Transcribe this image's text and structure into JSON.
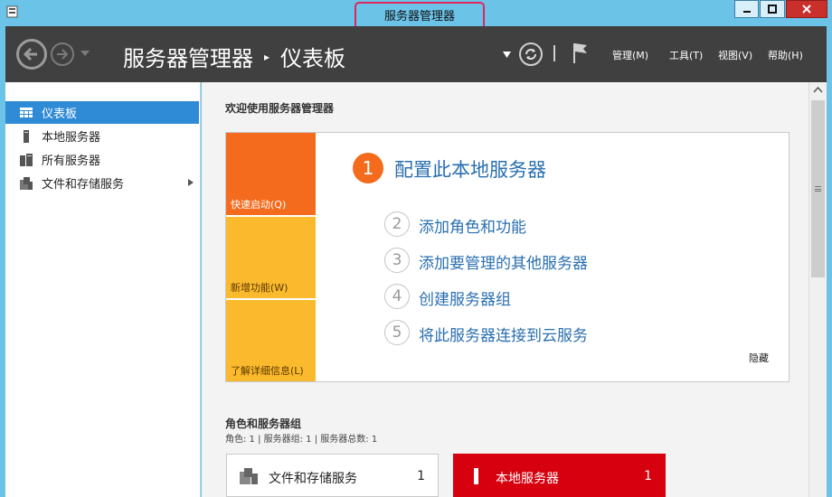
{
  "window": {
    "title": "服务器管理器"
  },
  "header": {
    "breadcrumb_root": "服务器管理器",
    "breadcrumb_sep": "▸",
    "breadcrumb_page": "仪表板",
    "menus": [
      {
        "label": "管理(M)"
      },
      {
        "label": "工具(T)"
      },
      {
        "label": "视图(V)"
      },
      {
        "label": "帮助(H)"
      }
    ]
  },
  "sidebar": {
    "items": [
      {
        "label": "仪表板",
        "icon": "dashboard-icon",
        "active": true
      },
      {
        "label": "本地服务器",
        "icon": "server-icon"
      },
      {
        "label": "所有服务器",
        "icon": "servers-icon"
      },
      {
        "label": "文件和存储服务",
        "icon": "file-storage-icon",
        "has_submenu": true
      }
    ]
  },
  "main": {
    "welcome": "欢迎使用服务器管理器",
    "quickstart": {
      "tiles": [
        "快速启动(Q)",
        "新增功能(W)",
        "了解详细信息(L)"
      ],
      "step1": {
        "num": "1",
        "text": "配置此本地服务器"
      },
      "steps": [
        {
          "num": "2",
          "text": "添加角色和功能"
        },
        {
          "num": "3",
          "text": "添加要管理的其他服务器"
        },
        {
          "num": "4",
          "text": "创建服务器组"
        },
        {
          "num": "5",
          "text": "将此服务器连接到云服务"
        }
      ],
      "hide": "隐藏"
    },
    "roles": {
      "title": "角色和服务器组",
      "subtitle": "角色: 1 | 服务器组: 1 | 服务器总数: 1",
      "cards": [
        {
          "name": "文件和存储服务",
          "count": "1",
          "icon": "file-storage-icon"
        },
        {
          "name": "本地服务器",
          "count": "1",
          "icon": "server-icon"
        }
      ]
    }
  },
  "colors": {
    "accent_orange": "#f46b1d",
    "tile_yellow": "#fbb92e",
    "link_blue": "#2a6fb0",
    "selected_blue": "#2f8bd6",
    "alert_red": "#d6000f",
    "header_dark": "#404040"
  }
}
